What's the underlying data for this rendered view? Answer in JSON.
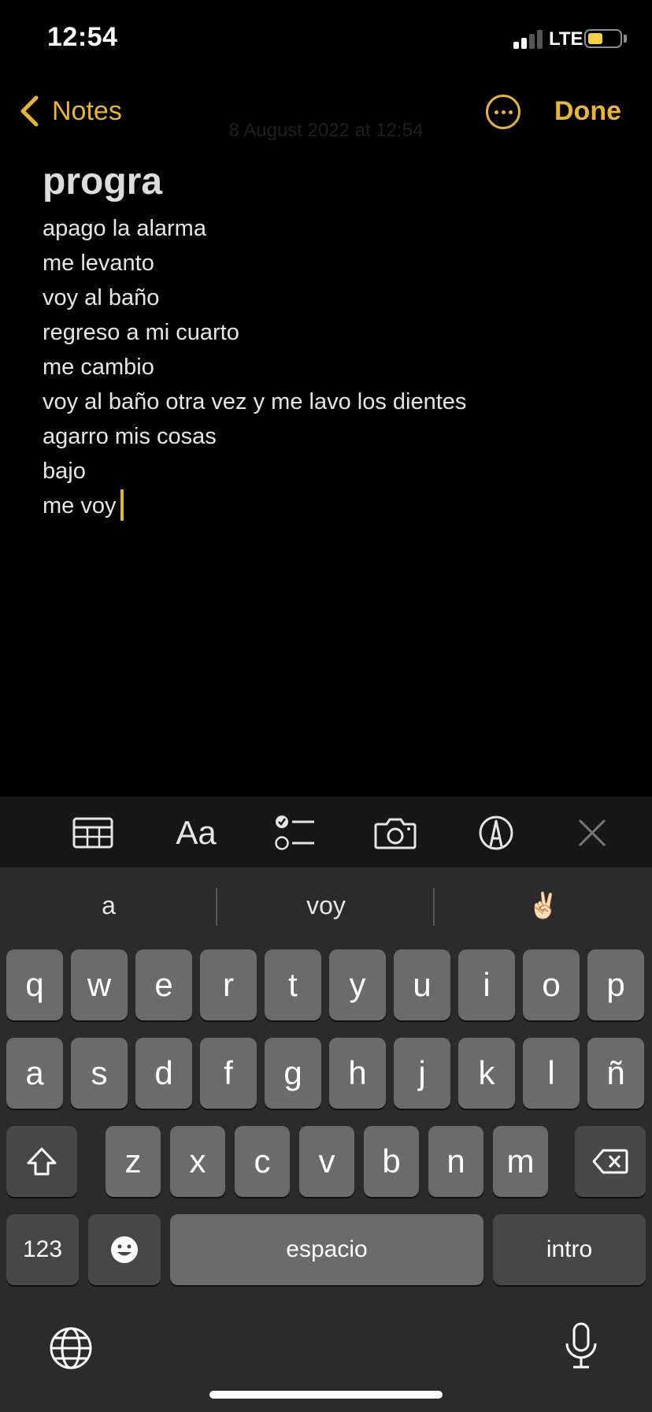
{
  "status_bar": {
    "time": "12:54",
    "network": "LTE",
    "signal_bars": 2,
    "battery_level": 0.45
  },
  "nav": {
    "back_label": "Notes",
    "done_label": "Done",
    "date": "8 August 2022 at 12:54"
  },
  "note": {
    "title": "progra",
    "lines": [
      "apago la alarma",
      "me levanto",
      "voy al baño",
      "regreso a mi cuarto",
      "me cambio",
      "voy al baño otra vez y me lavo los dientes",
      "agarro mis cosas",
      "bajo",
      "me voy"
    ]
  },
  "toolbar": {
    "format_label": "Aa"
  },
  "keyboard": {
    "predictions": [
      "a",
      "voy",
      "✌🏻"
    ],
    "row1": [
      "q",
      "w",
      "e",
      "r",
      "t",
      "y",
      "u",
      "i",
      "o",
      "p"
    ],
    "row2": [
      "a",
      "s",
      "d",
      "f",
      "g",
      "h",
      "j",
      "k",
      "l",
      "ñ"
    ],
    "row3": [
      "z",
      "x",
      "c",
      "v",
      "b",
      "n",
      "m"
    ],
    "numbers_label": "123",
    "space_label": "espacio",
    "return_label": "intro"
  },
  "colors": {
    "accent": "#e9b43c",
    "keyboard_bg": "#2b2b2b",
    "key": "#6b6b6b",
    "key_dark": "#474747"
  }
}
